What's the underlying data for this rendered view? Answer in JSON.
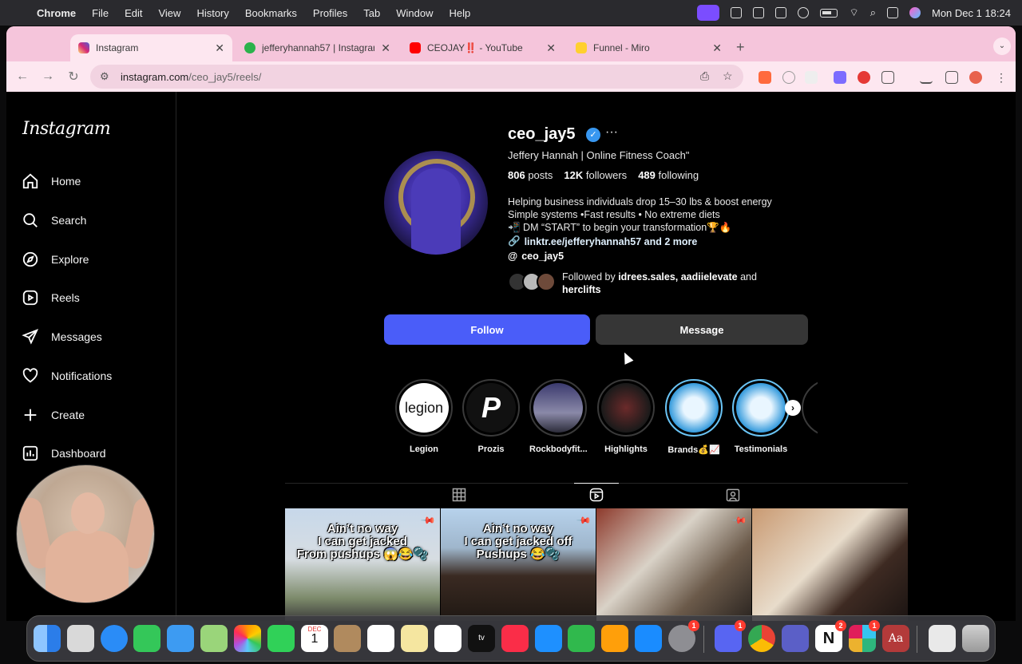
{
  "menubar": {
    "app": "Chrome",
    "items": [
      "File",
      "Edit",
      "View",
      "History",
      "Bookmarks",
      "Profiles",
      "Tab",
      "Window",
      "Help"
    ],
    "clock": "Mon Dec 1  18:24"
  },
  "browser": {
    "tabs": [
      {
        "title": "Instagram",
        "favicon_color": "#e1306c"
      },
      {
        "title": "jefferyhannah57 | Instagram,",
        "favicon_color": "#2bb24c"
      },
      {
        "title": "CEOJAY‼️ - YouTube",
        "favicon_color": "#ff0000"
      },
      {
        "title": "Funnel - Miro",
        "favicon_color": "#ffd02f"
      }
    ],
    "url_host": "instagram.com",
    "url_path": "/ceo_jay5/reels/"
  },
  "sidebar": {
    "logo": "Instagram",
    "items": [
      {
        "label": "Home",
        "icon": "home-icon"
      },
      {
        "label": "Search",
        "icon": "search-icon"
      },
      {
        "label": "Explore",
        "icon": "explore-icon"
      },
      {
        "label": "Reels",
        "icon": "reels-icon"
      },
      {
        "label": "Messages",
        "icon": "messages-icon"
      },
      {
        "label": "Notifications",
        "icon": "heart-icon"
      },
      {
        "label": "Create",
        "icon": "plus-icon"
      },
      {
        "label": "Dashboard",
        "icon": "dashboard-icon"
      }
    ]
  },
  "profile": {
    "username": "ceo_jay5",
    "full_name": "Jeffery Hannah | Online Fitness Coach\"",
    "posts_count": "806",
    "posts_label": "posts",
    "followers_count": "12K",
    "followers_label": "followers",
    "following_count": "489",
    "following_label": "following",
    "bio_lines": [
      "Helping business individuals drop 15–30 lbs & boost energy",
      "Simple systems •Fast results • No extreme diets",
      "📲 DM “START” to begin your transformation🏆🔥"
    ],
    "link": "linktr.ee/jefferyhannah57 and 2 more",
    "threads": "ceo_jay5",
    "followed_by_prefix": "Followed by ",
    "followed_by_names": "idrees.sales, aadiielevate",
    "followed_by_and": " and ",
    "followed_by_last": "herclifts",
    "follow_label": "Follow",
    "message_label": "Message"
  },
  "highlights": [
    {
      "label": "Legion",
      "text": "legion"
    },
    {
      "label": "Prozis",
      "text": "P"
    },
    {
      "label": "Rockbodyfit...",
      "text": ""
    },
    {
      "label": "Highlights",
      "text": ""
    },
    {
      "label": "Brands💰📈",
      "text": ""
    },
    {
      "label": "Testimonials",
      "text": ""
    }
  ],
  "reels": [
    {
      "caption": "Ain’t no way\nI can get jacked\nFrom pushups 😱😂🫧"
    },
    {
      "caption": "Ain’t no way\nI can get jacked off\nPushups 😂🫧"
    },
    {
      "caption": ""
    },
    {
      "caption": ""
    }
  ],
  "dock": {
    "badges": {
      "calendar_month": "DEC",
      "calendar_day": "1",
      "settings": "1",
      "discord": "1",
      "notion": "2",
      "slack": "1"
    }
  }
}
